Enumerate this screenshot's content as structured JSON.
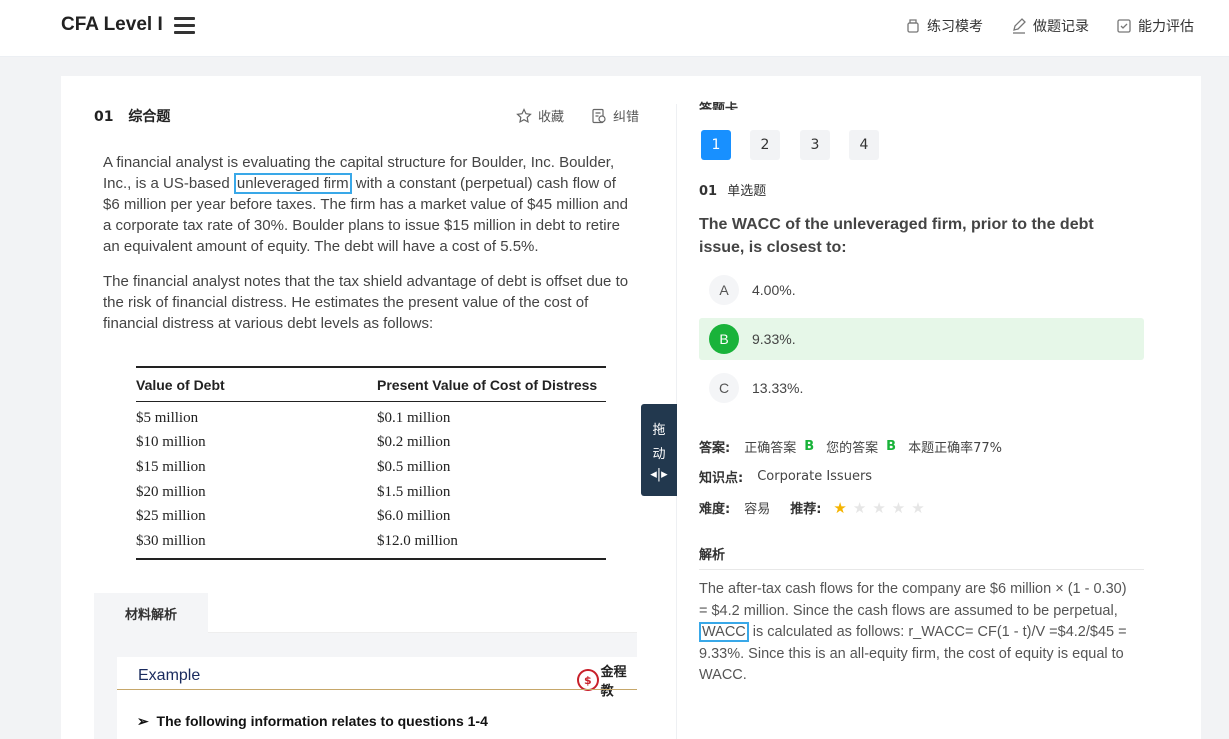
{
  "header": {
    "title": "CFA Level I",
    "nav": [
      {
        "label": "练习模考",
        "icon": "exam-icon"
      },
      {
        "label": "做题记录",
        "icon": "edit-record-icon"
      },
      {
        "label": "能力评估",
        "icon": "assessment-icon"
      }
    ]
  },
  "question": {
    "number": "01",
    "type": "综合题",
    "favorite_label": "收藏",
    "report_label": "纠错",
    "passage": {
      "p1_before": "A financial analyst is evaluating the capital structure for Boulder, Inc. Boulder, Inc., is a US-based ",
      "p1_highlight": "unleveraged firm",
      "p1_after": " with a constant (perpetual) cash flow of $6 million per year before taxes. The firm has a market value of $45 million and a corporate tax rate of 30%. Boulder plans to issue $15 million in debt to retire an equivalent amount of equity. The debt will have a cost of 5.5%.",
      "p2": "The financial analyst notes that the tax shield advantage of debt is offset due to the risk of financial distress. He estimates the present value of the cost of financial distress at various debt levels as follows:"
    },
    "table": {
      "headers": [
        "Value of Debt",
        "Present Value of Cost of Distress"
      ],
      "rows": [
        [
          "$5 million",
          "$0.1 million"
        ],
        [
          "$10 million",
          "$0.2 million"
        ],
        [
          "$15 million",
          "$0.5 million"
        ],
        [
          "$20 million",
          "$1.5 million"
        ],
        [
          "$25 million",
          "$6.0 million"
        ],
        [
          "$30 million",
          "$12.0 million"
        ]
      ]
    },
    "material_tab": "材料解析",
    "material": {
      "slide_title": "Example",
      "logo_text": "金程教",
      "bullet": "The following information relates to questions 1-4"
    }
  },
  "drag_handle": {
    "line1": "拖",
    "line2": "动",
    "icon": "resize-horizontal-icon"
  },
  "answer_card": {
    "label": "答题卡",
    "numbers": [
      "1",
      "2",
      "3",
      "4"
    ],
    "active": "1"
  },
  "sub_question": {
    "number": "01",
    "type": "单选题",
    "stem": "The WACC of the unleveraged firm, prior to the debt issue, is closest to:",
    "options": [
      {
        "letter": "A",
        "text": "4.00%."
      },
      {
        "letter": "B",
        "text": "9.33%."
      },
      {
        "letter": "C",
        "text": "13.33%."
      }
    ],
    "correct": "B"
  },
  "result": {
    "answer_key": "答案:",
    "correct_label": "正确答案",
    "correct_value": "B",
    "your_label": "您的答案",
    "your_value": "B",
    "rate": "本题正确率77%",
    "topic_key": "知识点:",
    "topic_value": "Corporate Issuers",
    "difficulty_key": "难度:",
    "difficulty_value": "容易",
    "recommend_key": "推荐:",
    "recommend_stars": 1,
    "stars_total": 5
  },
  "explanation": {
    "label": "解析",
    "before": "The after-tax cash flows for the company are $6 million × (1 - 0.30) = $4.2 million. Since the cash flows are assumed to be perpetual,",
    "highlight": "WACC",
    "after": "is calculated as follows: r_WACC= CF(1 - t)/V =$4.2/$45 = 9.33%. Since this is an all-equity firm, the cost of equity is equal to WACC."
  },
  "colors": {
    "primary": "#1890ff",
    "correct": "#19b33a",
    "correct_bg": "#e6f7e8",
    "highlight_border": "#39a8e8",
    "handle": "#22384e"
  }
}
